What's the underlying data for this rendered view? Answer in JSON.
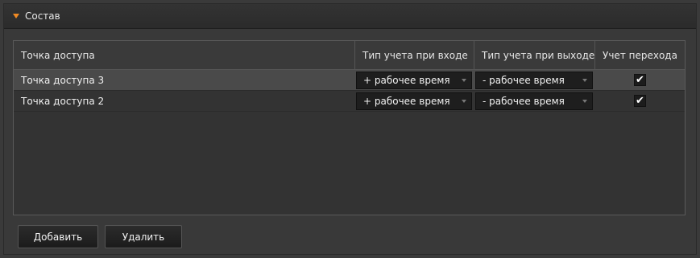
{
  "panel": {
    "title": "Состав"
  },
  "table": {
    "columns": [
      "Точка доступа",
      "Тип учета при входе",
      "Тип учета при выходе",
      "Учет перехода"
    ],
    "rows": [
      {
        "access_point": "Точка доступа 3",
        "entry_type": "+ рабочее время",
        "exit_type": "- рабочее время",
        "transition": "✔",
        "selected": true
      },
      {
        "access_point": "Точка доступа 2",
        "entry_type": "+ рабочее время",
        "exit_type": "- рабочее время",
        "transition": "✔",
        "selected": false
      }
    ]
  },
  "buttons": {
    "add": "Добавить",
    "delete": "Удалить"
  },
  "colors": {
    "background": "#3a3a3a",
    "accent_caret": "#f08a24",
    "selected_row": "#4a4a4a"
  }
}
